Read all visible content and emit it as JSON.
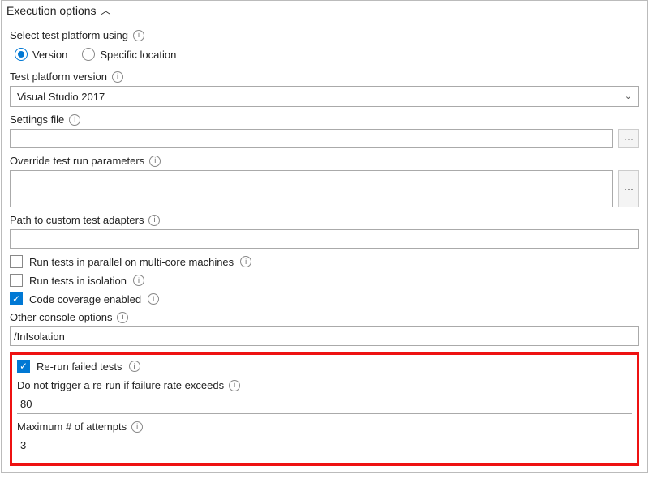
{
  "header": {
    "title": "Execution options"
  },
  "platformSelect": {
    "label": "Select test platform using",
    "options": {
      "version": "Version",
      "specific": "Specific location"
    }
  },
  "platformVersion": {
    "label": "Test platform version",
    "value": "Visual Studio 2017"
  },
  "settingsFile": {
    "label": "Settings file",
    "value": ""
  },
  "overrideParams": {
    "label": "Override test run parameters",
    "value": ""
  },
  "customAdapters": {
    "label": "Path to custom test adapters",
    "value": ""
  },
  "checks": {
    "parallel": "Run tests in parallel on multi-core machines",
    "isolation": "Run tests in isolation",
    "coverage": "Code coverage enabled"
  },
  "consoleOptions": {
    "label": "Other console options",
    "value": "/InIsolation"
  },
  "rerun": {
    "label": "Re-run failed tests",
    "failureRateLabel": "Do not trigger a re-run if failure rate exceeds",
    "failureRateValue": "80",
    "maxAttemptsLabel": "Maximum # of attempts",
    "maxAttemptsValue": "3"
  }
}
